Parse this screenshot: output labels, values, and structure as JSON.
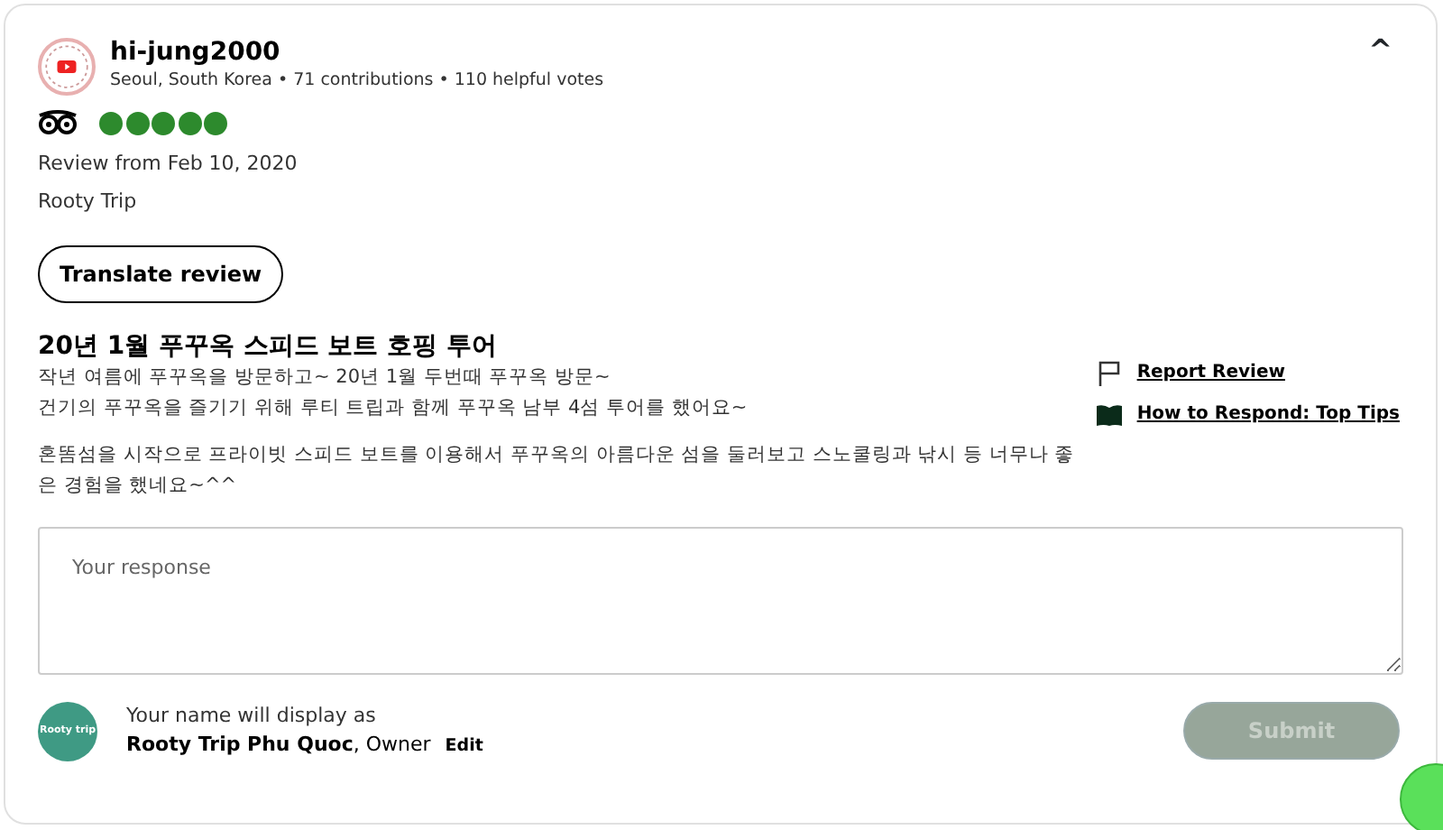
{
  "reviewer": {
    "name": "hi-jung2000",
    "meta": "Seoul, South Korea • 71 contributions • 110 helpful votes"
  },
  "collapse_toggle": {
    "label": "^",
    "expanded": true
  },
  "rating": {
    "stars": 5
  },
  "review_date": "Review from Feb 10, 2020",
  "business": "Rooty Trip",
  "translate_button": "Translate review",
  "review": {
    "title": "20년 1월 푸꾸옥 스피드 보트 호핑 투어",
    "paragraphs": [
      "작년 여름에 푸꾸옥을 방문하고~ 20년 1월 두번때 푸꾸옥 방문~\n건기의 푸꾸옥을 즐기기 위해 루티 트립과 함께 푸꾸옥 남부 4섬 투어를 했어요~",
      "혼똠섬을 시작으로 프라이빗 스피드 보트를 이용해서 푸꾸옥의 아름다운 섬을 둘러보고 스노쿨링과 낚시 등 너무나 좋은 경험을 했네요~^^"
    ]
  },
  "side_links": [
    {
      "kind": "flag",
      "label": "Report Review"
    },
    {
      "kind": "book",
      "label": "How to Respond: Top Tips"
    }
  ],
  "response": {
    "placeholder": "Your response"
  },
  "owner": {
    "logo_text": "Rooty trip",
    "note": "Your name will display as",
    "name": "Rooty Trip Phu Quoc",
    "role": ", Owner",
    "edit": "Edit"
  },
  "submit": {
    "label": "Submit",
    "disabled": true
  }
}
